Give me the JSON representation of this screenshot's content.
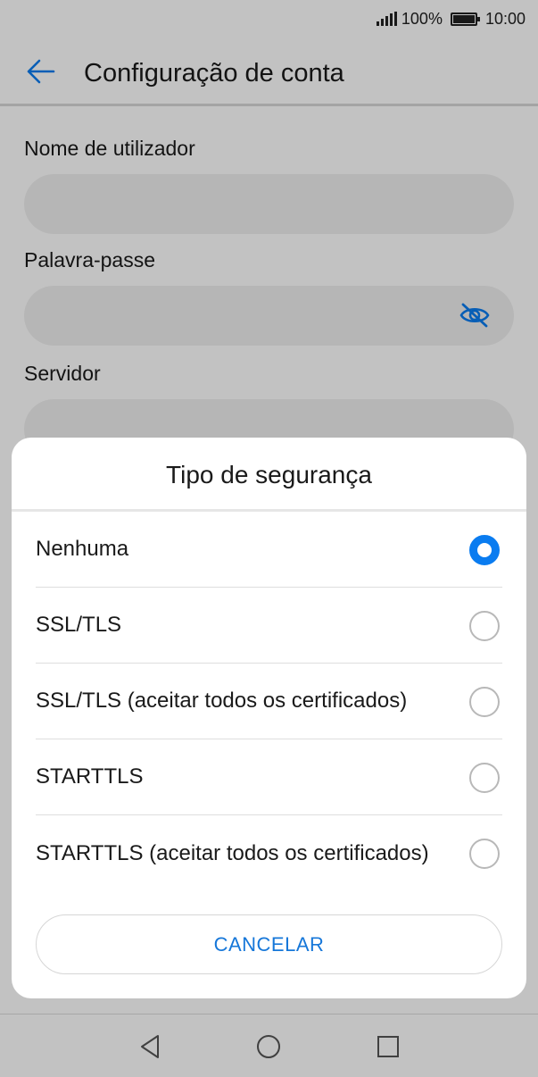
{
  "status_bar": {
    "battery_percent": "100%",
    "time": "10:00",
    "icons": [
      "signal-icon",
      "battery-icon"
    ]
  },
  "app_bar": {
    "title": "Configuração de conta",
    "back_icon": "arrow-left-icon"
  },
  "form": {
    "fields": [
      {
        "label": "Nome de utilizador",
        "value": ""
      },
      {
        "label": "Palavra-passe",
        "value": "",
        "icon": "eye-off-icon"
      },
      {
        "label": "Servidor",
        "value": ""
      }
    ]
  },
  "dialog": {
    "title": "Tipo de segurança",
    "options": [
      {
        "label": "Nenhuma",
        "selected": true
      },
      {
        "label": "SSL/TLS",
        "selected": false
      },
      {
        "label": "SSL/TLS (aceitar todos os certificados)",
        "selected": false
      },
      {
        "label": "STARTTLS",
        "selected": false
      },
      {
        "label": "STARTTLS (aceitar todos os certificados)",
        "selected": false
      }
    ],
    "cancel_label": "CANCELAR"
  },
  "nav_bar": {
    "icons": [
      "back-triangle-icon",
      "home-circle-icon",
      "recents-square-icon"
    ]
  },
  "colors": {
    "accent": "#0a7cf0",
    "accent_text": "#1677d9",
    "scrim": "rgba(0,0,0,0.24)"
  }
}
